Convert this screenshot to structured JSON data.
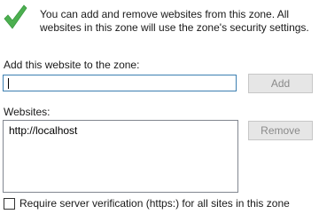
{
  "info": {
    "icon": "green-checkmark-icon",
    "text": "You can add and remove websites from this zone. All websites in this zone will use the zone's security settings."
  },
  "add_site": {
    "label": "Add this website to the zone:",
    "value": "",
    "button_label": "Add"
  },
  "websites": {
    "label": "Websites:",
    "items": [
      "http://localhost"
    ],
    "remove_button_label": "Remove"
  },
  "https_option": {
    "label": "Require server verification (https:) for all sites in this zone",
    "checked": false
  },
  "colors": {
    "check_green": "#4caf50",
    "input_border": "#3c7fb1",
    "disabled_button_bg": "#e6e6e6",
    "disabled_text": "#8a8a8a"
  }
}
